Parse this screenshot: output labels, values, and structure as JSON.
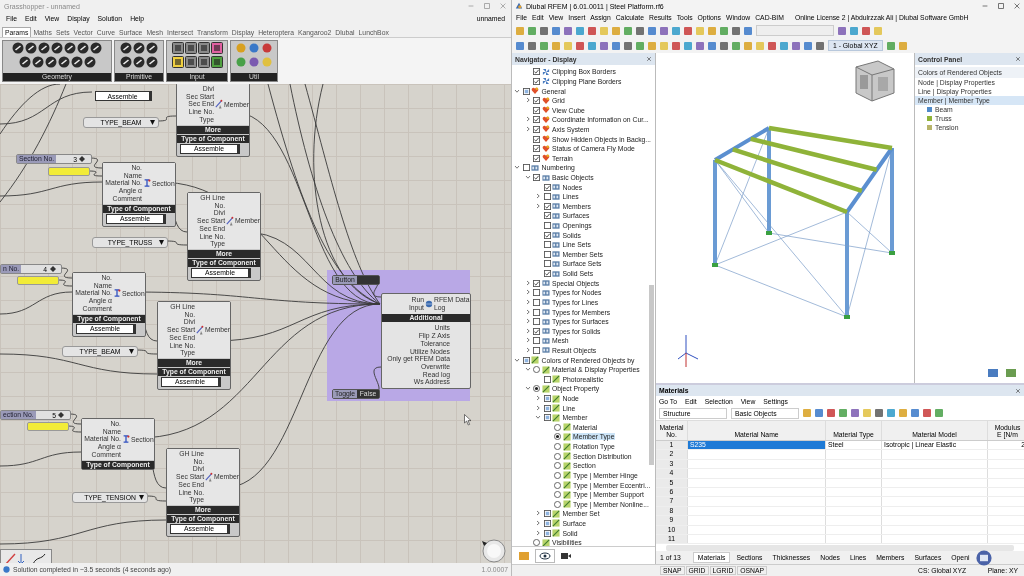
{
  "grasshopper": {
    "window_title": "Grasshopper - unnamed",
    "menu": [
      "File",
      "Edit",
      "View",
      "Display",
      "Solution",
      "Help"
    ],
    "document_name": "unnamed",
    "tabs": [
      {
        "label": "Params",
        "selected": true
      },
      {
        "label": "Maths",
        "selected": false
      },
      {
        "label": "Sets",
        "selected": false
      },
      {
        "label": "Vector",
        "selected": false
      },
      {
        "label": "Curve",
        "selected": false
      },
      {
        "label": "Surface",
        "selected": false
      },
      {
        "label": "Mesh",
        "selected": false
      },
      {
        "label": "Intersect",
        "selected": false
      },
      {
        "label": "Transform",
        "selected": false
      },
      {
        "label": "Display",
        "selected": false
      },
      {
        "label": "Heteroptera",
        "selected": false
      },
      {
        "label": "Kangaroo2",
        "selected": false
      },
      {
        "label": "Dlubal",
        "selected": false
      },
      {
        "label": "LunchBox",
        "selected": false
      }
    ],
    "toolbar_groups": [
      {
        "label": "Geometry",
        "kind": "geometry"
      },
      {
        "label": "Primitive",
        "kind": "primitive"
      },
      {
        "label": "Input",
        "kind": "input"
      },
      {
        "label": "Util",
        "kind": "util"
      }
    ],
    "canvas": {
      "top_button": "Assemble",
      "sliders": [
        {
          "label": "Section No.",
          "value": "3",
          "level": 0.9
        },
        {
          "label": "n No.",
          "value": "4",
          "level": 0.9
        },
        {
          "label": "ection No.",
          "value": "5",
          "level": 0.9
        }
      ],
      "value_lists": [
        {
          "value": "TYPE_BEAM"
        },
        {
          "value": "TYPE_TRUSS"
        },
        {
          "value": "TYPE_BEAM"
        },
        {
          "value": "TYPE_TENSION"
        }
      ],
      "components": [
        {
          "kind": "member",
          "inputs": [
            "Divi",
            "Sec Start",
            "Sec End",
            "Line No.",
            "Type"
          ],
          "output": "Member",
          "footer": [
            "More",
            "Type of Component"
          ],
          "button": "Assemble"
        },
        {
          "kind": "section",
          "inputs": [
            "No.",
            "Name",
            "Material No.",
            "Angle α",
            "Comment"
          ],
          "output": "Section",
          "footer": [
            "Type of Component"
          ],
          "button": "Assemble"
        },
        {
          "kind": "member",
          "inputs": [
            "GH Line",
            "No.",
            "Divi",
            "Sec Start",
            "Sec End",
            "Line No.",
            "Type"
          ],
          "output": "Member",
          "footer": [
            "More",
            "Type of Component"
          ],
          "button": "Assemble"
        },
        {
          "kind": "section",
          "inputs": [
            "No.",
            "Name",
            "Material No.",
            "Angle α",
            "Comment"
          ],
          "output": "Section",
          "footer": [
            "Type of Component"
          ],
          "button": "Assemble"
        },
        {
          "kind": "member",
          "inputs": [
            "GH Line",
            "No.",
            "Divi",
            "Sec Start",
            "Sec End",
            "Line No.",
            "Type"
          ],
          "output": "Member",
          "footer": [
            "More",
            "Type of Component"
          ],
          "button": "Assemble"
        },
        {
          "kind": "section",
          "inputs": [
            "No.",
            "Name",
            "Material No.",
            "Angle α",
            "Comment"
          ],
          "output": "Section",
          "footer": [
            "Type of Component"
          ]
        },
        {
          "kind": "member",
          "inputs": [
            "GH Line",
            "No.",
            "Divi",
            "Sec Start",
            "Sec End",
            "Line No.",
            "Type"
          ],
          "output": "Member",
          "footer": [
            "More",
            "Type of Component"
          ],
          "button": "Assemble"
        }
      ],
      "button_param": {
        "label": "Button"
      },
      "toggle": {
        "label": "Toggle",
        "value": "False"
      },
      "rfem_component": {
        "inputs": [
          "Run",
          "Input"
        ],
        "outputs": [
          "RFEM Data",
          "Log"
        ],
        "bar": "Additional",
        "options": [
          "Units",
          "Flip Z Axis",
          "Tolerance",
          "Utilize Nodes",
          "Only get RFEM Data",
          "Overwrite",
          "Read log",
          "Ws Address"
        ]
      }
    },
    "status": "Solution completed in ~3.5 seconds (4 seconds ago)",
    "version": "1.0.0007"
  },
  "rfem": {
    "window_title": "Dlubal RFEM | 6.01.0011 | Steel Platform.rf6",
    "menu": [
      "File",
      "Edit",
      "View",
      "Insert",
      "Assign",
      "Calculate",
      "Results",
      "Tools",
      "Options",
      "Window",
      "CAD-BIM"
    ],
    "license": "Online License 2 | Abdulrzzak  Ali | Dlubal Software GmbH",
    "view_selector": "1 - Global XYZ",
    "navigator": {
      "title": "Navigator - Display",
      "continued_items": [
        {
          "label": "Clipping Box Borders",
          "kind": "check",
          "checked": true,
          "partial": false,
          "selected": false
        },
        {
          "label": "Clipping Plane Borders",
          "kind": "check",
          "checked": true,
          "partial": false,
          "selected": false
        }
      ],
      "items": [
        {
          "label": "General",
          "kind": "check",
          "checked": false,
          "partial": true,
          "expanded": true,
          "selected": false,
          "children": [
            {
              "label": "Grid",
              "kind": "check",
              "checked": true,
              "partial": false,
              "expanded": false,
              "selected": false
            },
            {
              "label": "View Cube",
              "kind": "check",
              "checked": true,
              "partial": false,
              "selected": false
            },
            {
              "label": "Coordinate Information on Cur...",
              "kind": "check",
              "checked": true,
              "partial": false,
              "expanded": false,
              "selected": false
            },
            {
              "label": "Axis System",
              "kind": "check",
              "checked": true,
              "partial": false,
              "expanded": false,
              "selected": false
            },
            {
              "label": "Show Hidden Objects in Backg...",
              "kind": "check",
              "checked": true,
              "partial": false,
              "selected": false
            },
            {
              "label": "Status of Camera Fly Mode",
              "kind": "check",
              "checked": true,
              "partial": false,
              "selected": false
            },
            {
              "label": "Terrain",
              "kind": "check",
              "checked": true,
              "partial": false,
              "selected": false
            }
          ]
        },
        {
          "label": "Numbering",
          "kind": "check",
          "checked": false,
          "partial": false,
          "expanded": true,
          "selected": false,
          "children": [
            {
              "label": "Basic Objects",
              "kind": "check",
              "checked": true,
              "partial": false,
              "expanded": true,
              "selected": false,
              "children": [
                {
                  "label": "Nodes",
                  "kind": "check",
                  "checked": true,
                  "partial": false,
                  "selected": false
                },
                {
                  "label": "Lines",
                  "kind": "check",
                  "checked": false,
                  "partial": false,
                  "expanded": false,
                  "selected": false
                },
                {
                  "label": "Members",
                  "kind": "check",
                  "checked": true,
                  "partial": false,
                  "expanded": false,
                  "selected": false
                },
                {
                  "label": "Surfaces",
                  "kind": "check",
                  "checked": true,
                  "partial": false,
                  "selected": false
                },
                {
                  "label": "Openings",
                  "kind": "check",
                  "checked": false,
                  "partial": false,
                  "selected": false
                },
                {
                  "label": "Solids",
                  "kind": "check",
                  "checked": true,
                  "partial": false,
                  "selected": false
                },
                {
                  "label": "Line Sets",
                  "kind": "check",
                  "checked": false,
                  "partial": false,
                  "selected": false
                },
                {
                  "label": "Member Sets",
                  "kind": "check",
                  "checked": false,
                  "partial": false,
                  "selected": false
                },
                {
                  "label": "Surface Sets",
                  "kind": "check",
                  "checked": false,
                  "partial": false,
                  "selected": false
                },
                {
                  "label": "Solid Sets",
                  "kind": "check",
                  "checked": true,
                  "partial": false,
                  "selected": false
                }
              ]
            },
            {
              "label": "Special Objects",
              "kind": "check",
              "checked": true,
              "partial": false,
              "expanded": false,
              "selected": false
            },
            {
              "label": "Types for Nodes",
              "kind": "check",
              "checked": false,
              "partial": false,
              "expanded": false,
              "selected": false
            },
            {
              "label": "Types for Lines",
              "kind": "check",
              "checked": false,
              "partial": false,
              "expanded": false,
              "selected": false
            },
            {
              "label": "Types for Members",
              "kind": "check",
              "checked": false,
              "partial": false,
              "expanded": false,
              "selected": false
            },
            {
              "label": "Types for Surfaces",
              "kind": "check",
              "checked": false,
              "partial": false,
              "expanded": false,
              "selected": false
            },
            {
              "label": "Types for Solids",
              "kind": "check",
              "checked": true,
              "partial": false,
              "expanded": false,
              "selected": false
            },
            {
              "label": "Mesh",
              "kind": "check",
              "checked": false,
              "partial": false,
              "expanded": false,
              "selected": false
            },
            {
              "label": "Result Objects",
              "kind": "check",
              "checked": false,
              "partial": false,
              "expanded": false,
              "selected": false
            }
          ]
        },
        {
          "label": "Colors of Rendered Objects by",
          "kind": "check",
          "checked": false,
          "partial": true,
          "expanded": true,
          "selected": false,
          "children": [
            {
              "label": "Material & Display Properties",
              "kind": "radio",
              "checked": false,
              "partial": false,
              "expanded": true,
              "selected": false,
              "children": [
                {
                  "label": "Photorealistic",
                  "kind": "check",
                  "checked": false,
                  "partial": false,
                  "selected": false
                }
              ]
            },
            {
              "label": "Object Property",
              "kind": "radio",
              "checked": true,
              "partial": false,
              "expanded": true,
              "selected": false,
              "children": [
                {
                  "label": "Node",
                  "kind": "check",
                  "checked": false,
                  "partial": true,
                  "expanded": false,
                  "selected": false
                },
                {
                  "label": "Line",
                  "kind": "check",
                  "checked": false,
                  "partial": true,
                  "expanded": false,
                  "selected": false
                },
                {
                  "label": "Member",
                  "kind": "check",
                  "checked": false,
                  "partial": true,
                  "expanded": true,
                  "selected": false,
                  "children": [
                    {
                      "label": "Material",
                      "kind": "radio",
                      "checked": false,
                      "partial": false,
                      "selected": false
                    },
                    {
                      "label": "Member Type",
                      "kind": "radio",
                      "checked": true,
                      "partial": false,
                      "selected": true
                    },
                    {
                      "label": "Rotation Type",
                      "kind": "radio",
                      "checked": false,
                      "partial": false,
                      "selected": false
                    },
                    {
                      "label": "Section Distribution",
                      "kind": "radio",
                      "checked": false,
                      "partial": false,
                      "selected": false
                    },
                    {
                      "label": "Section",
                      "kind": "radio",
                      "checked": false,
                      "partial": false,
                      "selected": false
                    },
                    {
                      "label": "Type | Member Hinge",
                      "kind": "radio",
                      "checked": false,
                      "partial": false,
                      "selected": false
                    },
                    {
                      "label": "Type | Member Eccentri...",
                      "kind": "radio",
                      "checked": false,
                      "partial": false,
                      "selected": false
                    },
                    {
                      "label": "Type | Member Support",
                      "kind": "radio",
                      "checked": false,
                      "partial": false,
                      "selected": false
                    },
                    {
                      "label": "Type | Member Nonline...",
                      "kind": "radio",
                      "checked": false,
                      "partial": false,
                      "selected": false
                    }
                  ]
                },
                {
                  "label": "Member Set",
                  "kind": "check",
                  "checked": false,
                  "partial": true,
                  "expanded": false,
                  "selected": false
                },
                {
                  "label": "Surface",
                  "kind": "check",
                  "checked": false,
                  "partial": true,
                  "expanded": false,
                  "selected": false
                },
                {
                  "label": "Solid",
                  "kind": "check",
                  "checked": false,
                  "partial": true,
                  "expanded": false,
                  "selected": false
                }
              ]
            },
            {
              "label": "Visibilities",
              "kind": "radio",
              "checked": false,
              "partial": false,
              "selected": false
            }
          ]
        }
      ]
    },
    "control_panel": {
      "title": "Control Panel",
      "heading": "Colors of Rendered Objects",
      "options": [
        {
          "label": "Node | Display Properties",
          "selected": false
        },
        {
          "label": "Line | Display Properties",
          "selected": false
        },
        {
          "label": "Member | Member Type",
          "selected": true
        }
      ],
      "legend": [
        {
          "label": "Beam",
          "color": "#4f8ac9"
        },
        {
          "label": "Truss",
          "color": "#8fb339"
        },
        {
          "label": "Tension",
          "color": "#b7b46a"
        }
      ]
    },
    "materials": {
      "title": "Materials",
      "menu": [
        "Go To",
        "Edit",
        "Selection",
        "View",
        "Settings"
      ],
      "filters": [
        "Structure",
        "Basic Objects"
      ],
      "columns": [
        "Material No.",
        "Material Name",
        "Material Type",
        "Material Model",
        "Modulus E [N/m"
      ],
      "rows": [
        {
          "no": "1",
          "name": "S235",
          "type": "Steel",
          "model": "Isotropic | Linear Elastic",
          "modulus": "2",
          "selected": true
        },
        {
          "no": "2",
          "selected": false
        },
        {
          "no": "3",
          "selected": false
        },
        {
          "no": "4",
          "selected": false
        },
        {
          "no": "5",
          "selected": false
        },
        {
          "no": "6",
          "selected": false
        },
        {
          "no": "7",
          "selected": false
        },
        {
          "no": "8",
          "selected": false
        },
        {
          "no": "9",
          "selected": false
        },
        {
          "no": "10",
          "selected": false
        },
        {
          "no": "11",
          "selected": false
        }
      ],
      "pager": "1 of 13",
      "tabs": [
        {
          "label": "Materials",
          "selected": true
        },
        {
          "label": "Sections",
          "selected": false
        },
        {
          "label": "Thicknesses",
          "selected": false
        },
        {
          "label": "Nodes",
          "selected": false
        },
        {
          "label": "Lines",
          "selected": false
        },
        {
          "label": "Members",
          "selected": false
        },
        {
          "label": "Surfaces",
          "selected": false
        },
        {
          "label": "Openi",
          "selected": false
        }
      ]
    },
    "status_items": [
      "SNAP",
      "GRID",
      "LGRID",
      "OSNAP"
    ],
    "coordinate_system": "CS: Global XYZ",
    "plane": "Plane: XY"
  }
}
